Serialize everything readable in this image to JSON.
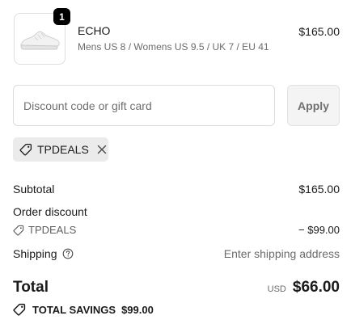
{
  "product": {
    "quantity_badge": "1",
    "name": "ECHO",
    "variant": "Mens US 8 / Womens US 9.5 / UK 7 / EU 41",
    "price": "$165.00",
    "image_icon": "sneaker-thumbnail"
  },
  "discount": {
    "placeholder": "Discount code or gift card",
    "value": "",
    "apply_label": "Apply"
  },
  "applied_code": {
    "label": "TPDEALS",
    "tag_icon": "tag-icon",
    "remove_icon": "close-icon"
  },
  "summary": {
    "subtotal_label": "Subtotal",
    "subtotal_value": "$165.00",
    "order_discount_label": "Order discount",
    "discount_code": "TPDEALS",
    "discount_value": "− $99.00",
    "shipping_label": "Shipping",
    "shipping_value": "Enter shipping address",
    "total_label": "Total",
    "currency": "USD",
    "total_value": "$66.00",
    "savings_label": "TOTAL SAVINGS",
    "savings_value": "$99.00"
  },
  "colors": {
    "text": "#1a1a1a",
    "muted": "#6b6b6b",
    "chip_bg": "#ebebeb",
    "badge_bg": "#000000"
  }
}
